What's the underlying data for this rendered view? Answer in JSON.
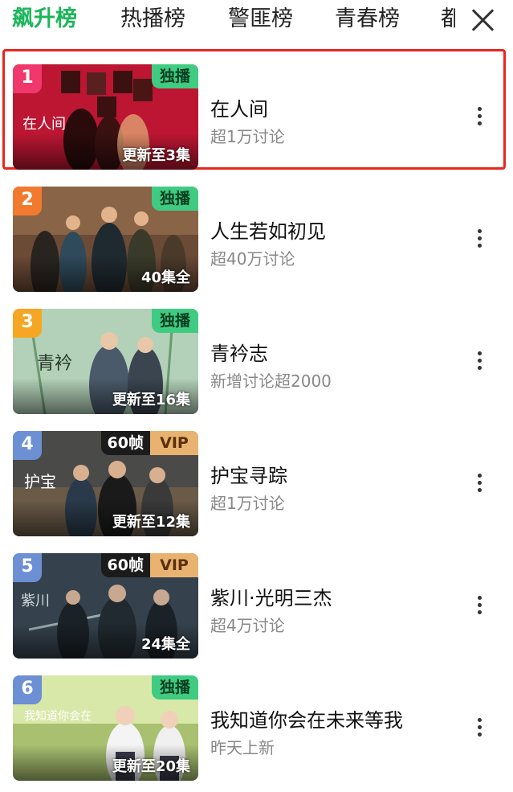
{
  "tabs": [
    "飙升榜",
    "热播榜",
    "警匪榜",
    "青春榜",
    "都"
  ],
  "accent": "#1bb65a",
  "highlight_color": "#e8271f",
  "items": [
    {
      "rank": "1",
      "title": "在人间",
      "sub": "超1万讨论",
      "episodes": "更新至3集",
      "badge": "独播",
      "rank_color": "#f0386c"
    },
    {
      "rank": "2",
      "title": "人生若如初见",
      "sub": "超40万讨论",
      "episodes": "40集全",
      "badge": "独播",
      "rank_color": "#f27a2f"
    },
    {
      "rank": "3",
      "title": "青衿志",
      "sub": "新增讨论超2000",
      "episodes": "更新至16集",
      "badge": "独播",
      "rank_color": "#f5a623"
    },
    {
      "rank": "4",
      "title": "护宝寻踪",
      "sub": "超1万讨论",
      "episodes": "更新至12集",
      "fps": "60帧",
      "vip": "VIP",
      "rank_color": "#6d8fd4"
    },
    {
      "rank": "5",
      "title": "紫川·光明三杰",
      "sub": "超4万讨论",
      "episodes": "24集全",
      "fps": "60帧",
      "vip": "VIP",
      "rank_color": "#6d8fd4"
    },
    {
      "rank": "6",
      "title": "我知道你会在未来等我",
      "sub": "昨天上新",
      "episodes": "更新至20集",
      "badge": "独播",
      "rank_color": "#6d8fd4"
    }
  ]
}
